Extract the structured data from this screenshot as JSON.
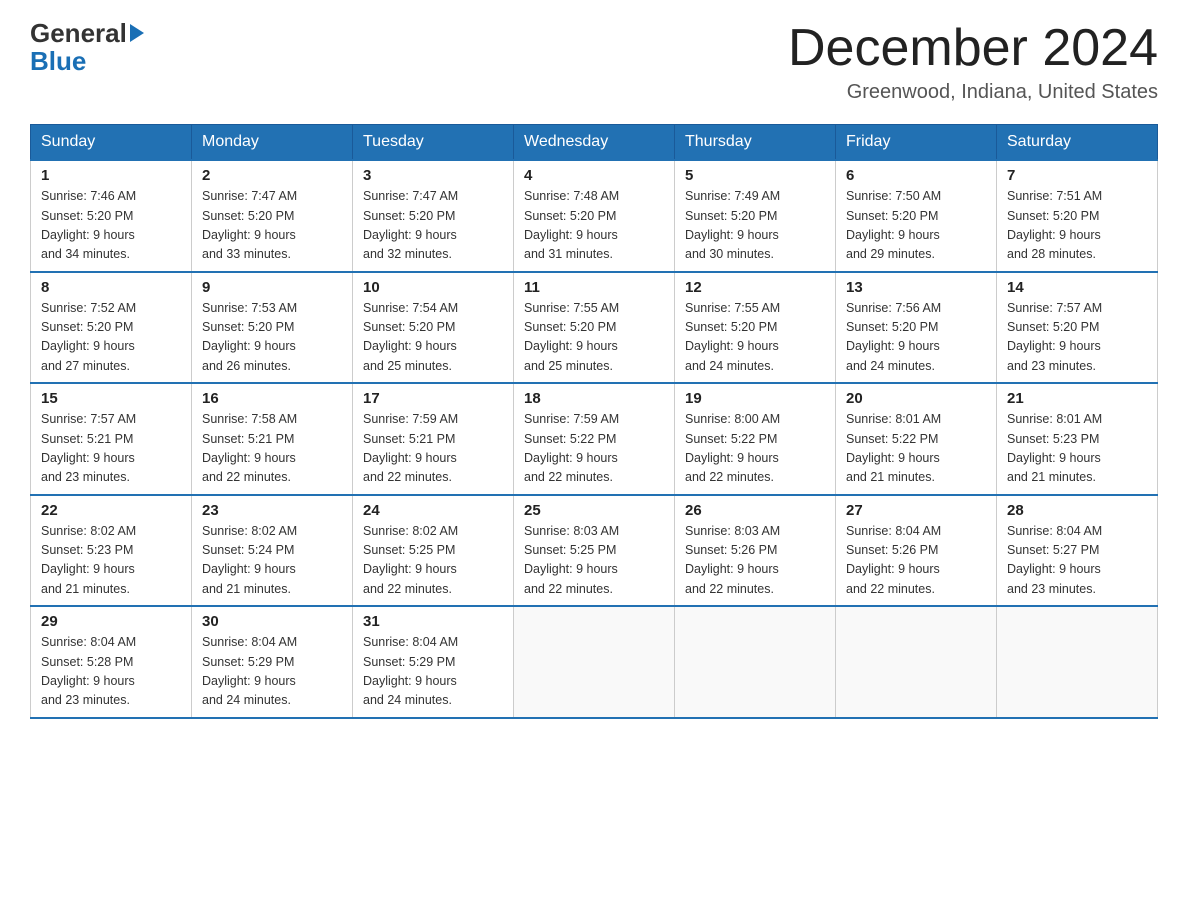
{
  "header": {
    "logo_line1": "General",
    "logo_line2": "Blue",
    "month_title": "December 2024",
    "location": "Greenwood, Indiana, United States"
  },
  "days_of_week": [
    "Sunday",
    "Monday",
    "Tuesday",
    "Wednesday",
    "Thursday",
    "Friday",
    "Saturday"
  ],
  "weeks": [
    [
      {
        "num": "1",
        "sunrise": "7:46 AM",
        "sunset": "5:20 PM",
        "daylight": "9 hours and 34 minutes."
      },
      {
        "num": "2",
        "sunrise": "7:47 AM",
        "sunset": "5:20 PM",
        "daylight": "9 hours and 33 minutes."
      },
      {
        "num": "3",
        "sunrise": "7:47 AM",
        "sunset": "5:20 PM",
        "daylight": "9 hours and 32 minutes."
      },
      {
        "num": "4",
        "sunrise": "7:48 AM",
        "sunset": "5:20 PM",
        "daylight": "9 hours and 31 minutes."
      },
      {
        "num": "5",
        "sunrise": "7:49 AM",
        "sunset": "5:20 PM",
        "daylight": "9 hours and 30 minutes."
      },
      {
        "num": "6",
        "sunrise": "7:50 AM",
        "sunset": "5:20 PM",
        "daylight": "9 hours and 29 minutes."
      },
      {
        "num": "7",
        "sunrise": "7:51 AM",
        "sunset": "5:20 PM",
        "daylight": "9 hours and 28 minutes."
      }
    ],
    [
      {
        "num": "8",
        "sunrise": "7:52 AM",
        "sunset": "5:20 PM",
        "daylight": "9 hours and 27 minutes."
      },
      {
        "num": "9",
        "sunrise": "7:53 AM",
        "sunset": "5:20 PM",
        "daylight": "9 hours and 26 minutes."
      },
      {
        "num": "10",
        "sunrise": "7:54 AM",
        "sunset": "5:20 PM",
        "daylight": "9 hours and 25 minutes."
      },
      {
        "num": "11",
        "sunrise": "7:55 AM",
        "sunset": "5:20 PM",
        "daylight": "9 hours and 25 minutes."
      },
      {
        "num": "12",
        "sunrise": "7:55 AM",
        "sunset": "5:20 PM",
        "daylight": "9 hours and 24 minutes."
      },
      {
        "num": "13",
        "sunrise": "7:56 AM",
        "sunset": "5:20 PM",
        "daylight": "9 hours and 24 minutes."
      },
      {
        "num": "14",
        "sunrise": "7:57 AM",
        "sunset": "5:20 PM",
        "daylight": "9 hours and 23 minutes."
      }
    ],
    [
      {
        "num": "15",
        "sunrise": "7:57 AM",
        "sunset": "5:21 PM",
        "daylight": "9 hours and 23 minutes."
      },
      {
        "num": "16",
        "sunrise": "7:58 AM",
        "sunset": "5:21 PM",
        "daylight": "9 hours and 22 minutes."
      },
      {
        "num": "17",
        "sunrise": "7:59 AM",
        "sunset": "5:21 PM",
        "daylight": "9 hours and 22 minutes."
      },
      {
        "num": "18",
        "sunrise": "7:59 AM",
        "sunset": "5:22 PM",
        "daylight": "9 hours and 22 minutes."
      },
      {
        "num": "19",
        "sunrise": "8:00 AM",
        "sunset": "5:22 PM",
        "daylight": "9 hours and 22 minutes."
      },
      {
        "num": "20",
        "sunrise": "8:01 AM",
        "sunset": "5:22 PM",
        "daylight": "9 hours and 21 minutes."
      },
      {
        "num": "21",
        "sunrise": "8:01 AM",
        "sunset": "5:23 PM",
        "daylight": "9 hours and 21 minutes."
      }
    ],
    [
      {
        "num": "22",
        "sunrise": "8:02 AM",
        "sunset": "5:23 PM",
        "daylight": "9 hours and 21 minutes."
      },
      {
        "num": "23",
        "sunrise": "8:02 AM",
        "sunset": "5:24 PM",
        "daylight": "9 hours and 21 minutes."
      },
      {
        "num": "24",
        "sunrise": "8:02 AM",
        "sunset": "5:25 PM",
        "daylight": "9 hours and 22 minutes."
      },
      {
        "num": "25",
        "sunrise": "8:03 AM",
        "sunset": "5:25 PM",
        "daylight": "9 hours and 22 minutes."
      },
      {
        "num": "26",
        "sunrise": "8:03 AM",
        "sunset": "5:26 PM",
        "daylight": "9 hours and 22 minutes."
      },
      {
        "num": "27",
        "sunrise": "8:04 AM",
        "sunset": "5:26 PM",
        "daylight": "9 hours and 22 minutes."
      },
      {
        "num": "28",
        "sunrise": "8:04 AM",
        "sunset": "5:27 PM",
        "daylight": "9 hours and 23 minutes."
      }
    ],
    [
      {
        "num": "29",
        "sunrise": "8:04 AM",
        "sunset": "5:28 PM",
        "daylight": "9 hours and 23 minutes."
      },
      {
        "num": "30",
        "sunrise": "8:04 AM",
        "sunset": "5:29 PM",
        "daylight": "9 hours and 24 minutes."
      },
      {
        "num": "31",
        "sunrise": "8:04 AM",
        "sunset": "5:29 PM",
        "daylight": "9 hours and 24 minutes."
      },
      null,
      null,
      null,
      null
    ]
  ],
  "labels": {
    "sunrise": "Sunrise:",
    "sunset": "Sunset:",
    "daylight": "Daylight:"
  }
}
